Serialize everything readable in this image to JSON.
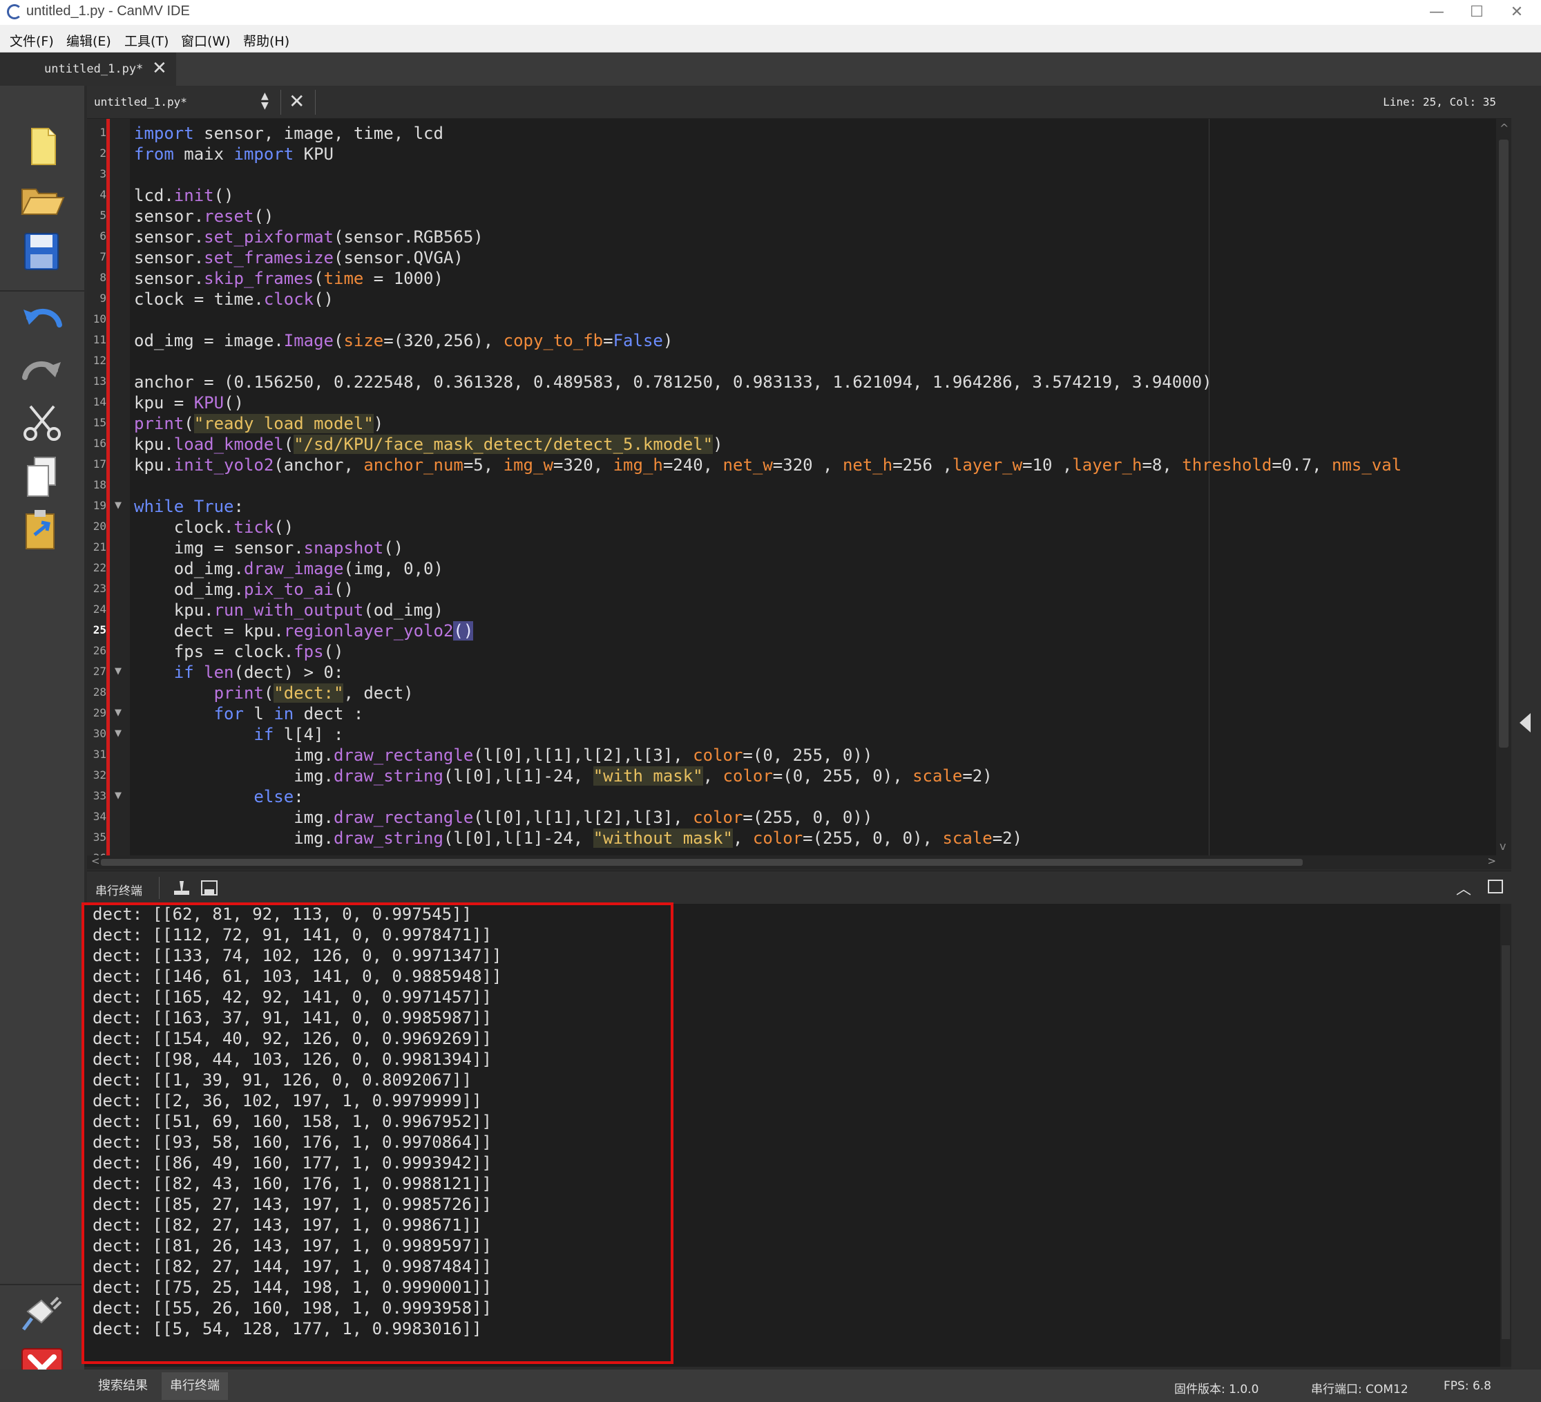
{
  "window": {
    "title": "untitled_1.py - CanMV IDE",
    "minimize": "—",
    "maximize": "☐",
    "close": "✕"
  },
  "menu": [
    "文件(F)",
    "编辑(E)",
    "工具(T)",
    "窗口(W)",
    "帮助(H)"
  ],
  "doc_tab": {
    "label": "untitled_1.py*",
    "close": "✕"
  },
  "editor": {
    "file": "untitled_1.py*",
    "close": "✕",
    "cursor": "Line: 25, Col: 35",
    "current_line": 25
  },
  "code": [
    [
      [
        "kw",
        "import"
      ],
      [
        "t",
        " sensor, image, time, lcd"
      ]
    ],
    [
      [
        "kw",
        "from"
      ],
      [
        "t",
        " maix "
      ],
      [
        "kw",
        "import"
      ],
      [
        "t",
        " KPU"
      ]
    ],
    [],
    [
      [
        "t",
        "lcd."
      ],
      [
        "fn",
        "init"
      ],
      [
        "t",
        "()"
      ]
    ],
    [
      [
        "t",
        "sensor."
      ],
      [
        "fn",
        "reset"
      ],
      [
        "t",
        "()"
      ]
    ],
    [
      [
        "t",
        "sensor."
      ],
      [
        "fn",
        "set_pixformat"
      ],
      [
        "t",
        "(sensor.RGB565)"
      ]
    ],
    [
      [
        "t",
        "sensor."
      ],
      [
        "fn",
        "set_framesize"
      ],
      [
        "t",
        "(sensor.QVGA)"
      ]
    ],
    [
      [
        "t",
        "sensor."
      ],
      [
        "fn",
        "skip_frames"
      ],
      [
        "t",
        "("
      ],
      [
        "pa",
        "time"
      ],
      [
        "t",
        " = 1000)"
      ]
    ],
    [
      [
        "t",
        "clock = time."
      ],
      [
        "fn",
        "clock"
      ],
      [
        "t",
        "()"
      ]
    ],
    [],
    [
      [
        "t",
        "od_img = image."
      ],
      [
        "fn",
        "Image"
      ],
      [
        "t",
        "("
      ],
      [
        "pa",
        "size"
      ],
      [
        "t",
        "=(320,256), "
      ],
      [
        "pa",
        "copy_to_fb"
      ],
      [
        "t",
        "="
      ],
      [
        "kw",
        "False"
      ],
      [
        "t",
        ")"
      ]
    ],
    [],
    [
      [
        "t",
        "anchor = (0.156250, 0.222548, 0.361328, 0.489583, 0.781250, 0.983133, 1.621094, 1.964286, 3.574219, 3.94000)"
      ]
    ],
    [
      [
        "t",
        "kpu = "
      ],
      [
        "fn",
        "KPU"
      ],
      [
        "t",
        "()"
      ]
    ],
    [
      [
        "fn",
        "print"
      ],
      [
        "t",
        "("
      ],
      [
        "st",
        "\"ready load model\""
      ],
      [
        "t",
        ")"
      ]
    ],
    [
      [
        "t",
        "kpu."
      ],
      [
        "fn",
        "load_kmodel"
      ],
      [
        "t",
        "("
      ],
      [
        "st",
        "\"/sd/KPU/face_mask_detect/detect_5.kmodel\""
      ],
      [
        "t",
        ")"
      ]
    ],
    [
      [
        "t",
        "kpu."
      ],
      [
        "fn",
        "init_yolo2"
      ],
      [
        "t",
        "(anchor, "
      ],
      [
        "pa",
        "anchor_num"
      ],
      [
        "t",
        "=5, "
      ],
      [
        "pa",
        "img_w"
      ],
      [
        "t",
        "=320, "
      ],
      [
        "pa",
        "img_h"
      ],
      [
        "t",
        "=240, "
      ],
      [
        "pa",
        "net_w"
      ],
      [
        "t",
        "=320 , "
      ],
      [
        "pa",
        "net_h"
      ],
      [
        "t",
        "=256 ,"
      ],
      [
        "pa",
        "layer_w"
      ],
      [
        "t",
        "=10 ,"
      ],
      [
        "pa",
        "layer_h"
      ],
      [
        "t",
        "=8, "
      ],
      [
        "pa",
        "threshold"
      ],
      [
        "t",
        "=0.7, "
      ],
      [
        "pa",
        "nms_val"
      ]
    ],
    [],
    [
      [
        "kw",
        "while"
      ],
      [
        "t",
        " "
      ],
      [
        "kw",
        "True"
      ],
      [
        "t",
        ":"
      ]
    ],
    [
      [
        "t",
        "    clock."
      ],
      [
        "fn",
        "tick"
      ],
      [
        "t",
        "()"
      ]
    ],
    [
      [
        "t",
        "    img = sensor."
      ],
      [
        "fn",
        "snapshot"
      ],
      [
        "t",
        "()"
      ]
    ],
    [
      [
        "t",
        "    od_img."
      ],
      [
        "fn",
        "draw_image"
      ],
      [
        "t",
        "(img, 0,0)"
      ]
    ],
    [
      [
        "t",
        "    od_img."
      ],
      [
        "fn",
        "pix_to_ai"
      ],
      [
        "t",
        "()"
      ]
    ],
    [
      [
        "t",
        "    kpu."
      ],
      [
        "fn",
        "run_with_output"
      ],
      [
        "t",
        "(od_img)"
      ]
    ],
    [
      [
        "t",
        "    dect = kpu."
      ],
      [
        "fn",
        "regionlayer_yolo2"
      ],
      [
        "hl",
        "()"
      ]
    ],
    [
      [
        "t",
        "    fps = clock."
      ],
      [
        "fn",
        "fps"
      ],
      [
        "t",
        "()"
      ]
    ],
    [
      [
        "t",
        "    "
      ],
      [
        "kw",
        "if"
      ],
      [
        "t",
        " "
      ],
      [
        "fn",
        "len"
      ],
      [
        "t",
        "(dect) > 0:"
      ]
    ],
    [
      [
        "t",
        "        "
      ],
      [
        "fn",
        "print"
      ],
      [
        "t",
        "("
      ],
      [
        "st",
        "\"dect:\""
      ],
      [
        "t",
        ", dect)"
      ]
    ],
    [
      [
        "t",
        "        "
      ],
      [
        "kw",
        "for"
      ],
      [
        "t",
        " l "
      ],
      [
        "kw",
        "in"
      ],
      [
        "t",
        " dect :"
      ]
    ],
    [
      [
        "t",
        "            "
      ],
      [
        "kw",
        "if"
      ],
      [
        "t",
        " l[4] :"
      ]
    ],
    [
      [
        "t",
        "                img."
      ],
      [
        "fn",
        "draw_rectangle"
      ],
      [
        "t",
        "(l[0],l[1],l[2],l[3], "
      ],
      [
        "pa",
        "color"
      ],
      [
        "t",
        "=(0, 255, 0))"
      ]
    ],
    [
      [
        "t",
        "                img."
      ],
      [
        "fn",
        "draw_string"
      ],
      [
        "t",
        "(l[0],l[1]-24, "
      ],
      [
        "st",
        "\"with mask\""
      ],
      [
        "t",
        ", "
      ],
      [
        "pa",
        "color"
      ],
      [
        "t",
        "=(0, 255, 0), "
      ],
      [
        "pa",
        "scale"
      ],
      [
        "t",
        "=2)"
      ]
    ],
    [
      [
        "t",
        "            "
      ],
      [
        "kw",
        "else"
      ],
      [
        "t",
        ":"
      ]
    ],
    [
      [
        "t",
        "                img."
      ],
      [
        "fn",
        "draw_rectangle"
      ],
      [
        "t",
        "(l[0],l[1],l[2],l[3], "
      ],
      [
        "pa",
        "color"
      ],
      [
        "t",
        "=(255, 0, 0))"
      ]
    ],
    [
      [
        "t",
        "                img."
      ],
      [
        "fn",
        "draw_string"
      ],
      [
        "t",
        "(l[0],l[1]-24, "
      ],
      [
        "st",
        "\"without mask\""
      ],
      [
        "t",
        ", "
      ],
      [
        "pa",
        "color"
      ],
      [
        "t",
        "=(255, 0, 0), "
      ],
      [
        "pa",
        "scale"
      ],
      [
        "t",
        "=2)"
      ]
    ],
    []
  ],
  "fold_lines": [
    19,
    27,
    29,
    30,
    33
  ],
  "terminal": {
    "title": "串行终端",
    "lines": [
      "dect: [[62, 81, 92, 113, 0, 0.997545]]",
      "dect: [[112, 72, 91, 141, 0, 0.9978471]]",
      "dect: [[133, 74, 102, 126, 0, 0.9971347]]",
      "dect: [[146, 61, 103, 141, 0, 0.9885948]]",
      "dect: [[165, 42, 92, 141, 0, 0.9971457]]",
      "dect: [[163, 37, 91, 141, 0, 0.9985987]]",
      "dect: [[154, 40, 92, 126, 0, 0.9969269]]",
      "dect: [[98, 44, 103, 126, 0, 0.9981394]]",
      "dect: [[1, 39, 91, 126, 0, 0.8092067]]",
      "dect: [[2, 36, 102, 197, 1, 0.9979999]]",
      "dect: [[51, 69, 160, 158, 1, 0.9967952]]",
      "dect: [[93, 58, 160, 176, 1, 0.9970864]]",
      "dect: [[86, 49, 160, 177, 1, 0.9993942]]",
      "dect: [[82, 43, 160, 176, 1, 0.9988121]]",
      "dect: [[85, 27, 143, 197, 1, 0.9985726]]",
      "dect: [[82, 27, 143, 197, 1, 0.998671]]",
      "dect: [[81, 26, 143, 197, 1, 0.9989597]]",
      "dect: [[82, 27, 144, 197, 1, 0.9987484]]",
      "dect: [[75, 25, 144, 198, 1, 0.9990001]]",
      "dect: [[55, 26, 160, 198, 1, 0.9993958]]",
      "dect: [[5, 54, 128, 177, 1, 0.9983016]]"
    ]
  },
  "status": {
    "tabs": [
      "搜索结果",
      "串行终端"
    ],
    "firmware": "固件版本: 1.0.0",
    "port": "串行端口: COM12",
    "fps": "FPS:   6.8"
  },
  "colors": {
    "keyword": "#6b8cff",
    "function": "#bb75e0",
    "string": "#e8c060",
    "param": "#f08a3a",
    "highlight_box": "#e01010"
  }
}
